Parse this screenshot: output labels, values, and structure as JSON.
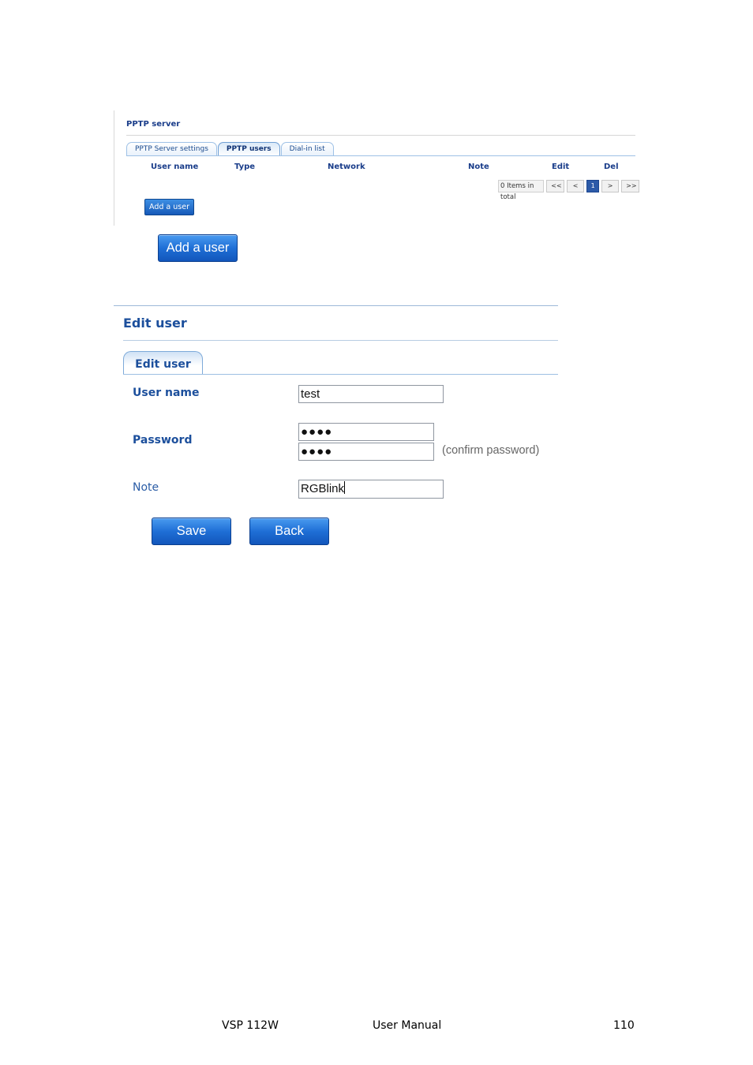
{
  "pptp": {
    "title": "PPTP server",
    "tabs": [
      {
        "label": "PPTP Server settings",
        "active": false
      },
      {
        "label": "PPTP users",
        "active": true
      },
      {
        "label": "Dial-in list",
        "active": false
      }
    ],
    "columns": [
      "User name",
      "Type",
      "Network",
      "Note",
      "Edit",
      "Del"
    ],
    "pager": {
      "total_text": "0 Items in total",
      "first": "<<",
      "prev": "<",
      "current_page": "1",
      "next": ">",
      "last": ">>"
    },
    "add_button": "Add a user"
  },
  "big_add_button": "Add a user",
  "edit_user": {
    "title": "Edit user",
    "tab": "Edit user",
    "username_label": "User name",
    "username_value": "test",
    "password_label": "Password",
    "password_value": "●●●●",
    "confirm_value": "●●●●",
    "confirm_hint": "(confirm password)",
    "note_label": "Note",
    "note_value": "RGBlink",
    "save_label": "Save",
    "back_label": "Back"
  },
  "footer": {
    "product": "VSP 112W",
    "doc": "User Manual",
    "page": "110"
  },
  "colors": {
    "accent": "#1c4f9c",
    "button": "#1f6fd6",
    "tab_border": "#7eaad9"
  }
}
